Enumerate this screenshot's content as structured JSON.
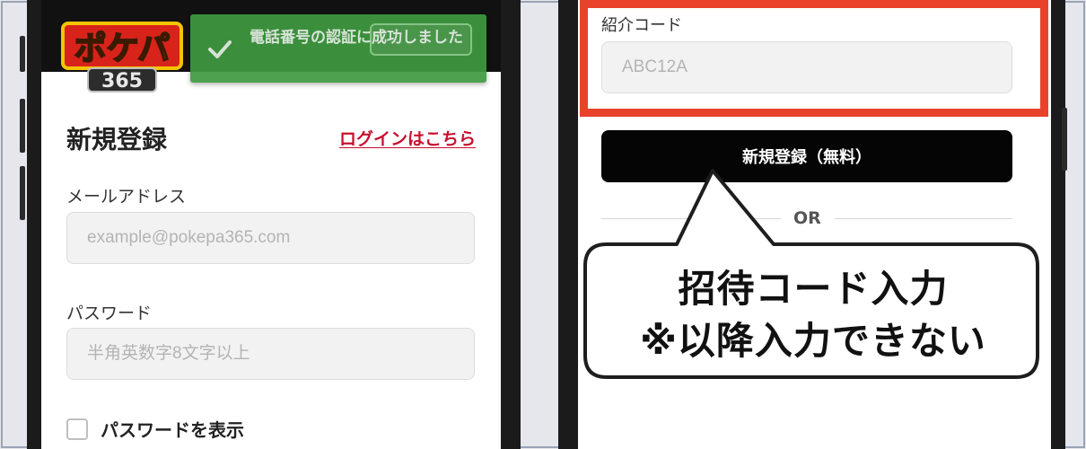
{
  "left_phone": {
    "logo_text": "ポケパ365",
    "toast": {
      "message": "電話番号の認証に成功しました",
      "status_color": "#3f9a40"
    },
    "title": "新規登録",
    "login_link": "ログインはこちら",
    "email": {
      "label": "メールアドレス",
      "placeholder": "example@pokepa365.com"
    },
    "password": {
      "label": "パスワード",
      "placeholder": "半角英数字8文字以上"
    },
    "show_password_label": "パスワードを表示"
  },
  "right_phone": {
    "referral": {
      "label": "紹介コード",
      "placeholder": "ABC12A"
    },
    "register_button": "新規登録（無料）",
    "divider_text": "OR",
    "callout": {
      "line1": "招待コード入力",
      "line2": "※以降入力できない"
    },
    "highlight_color": "#e8432a"
  },
  "colors": {
    "accent_red": "#c8102e",
    "success_green": "#3f9a40",
    "primary_button": "#050505"
  }
}
